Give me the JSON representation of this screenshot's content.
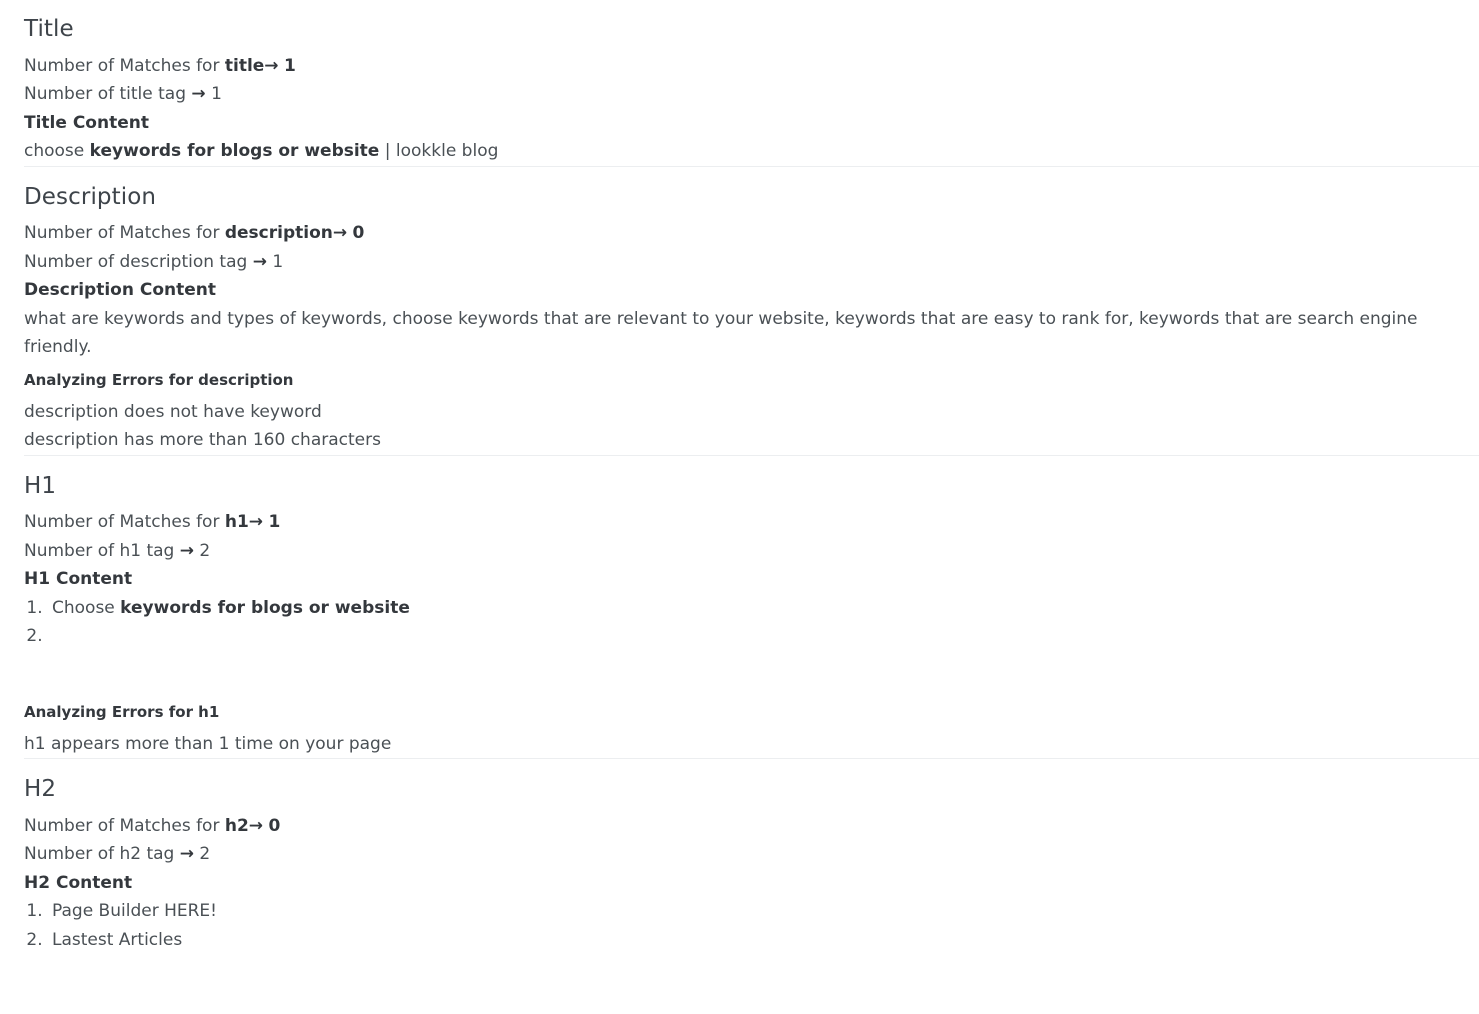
{
  "arrow_glyph": "→",
  "colors": {
    "background": "#ffffff",
    "body_text": "#4a5055",
    "strong_text": "#34383d",
    "heading_text": "#3e444a",
    "divider": "#eceef0"
  },
  "sections": [
    {
      "id": "title",
      "heading": "Title",
      "matches_prefix": "Number of Matches for ",
      "matches_term": "title",
      "matches_value": "1",
      "tag_count_prefix": "Number of title tag ",
      "tag_count_value": "1",
      "content_label": "Title Content",
      "content_plain_before": "choose ",
      "content_strong": "keywords for blogs or website",
      "content_plain_after": " | lookkle blog"
    },
    {
      "id": "description",
      "heading": "Description",
      "matches_prefix": "Number of Matches for ",
      "matches_term": "description",
      "matches_value": "0",
      "tag_count_prefix": "Number of description tag ",
      "tag_count_value": "1",
      "content_label": "Description Content",
      "content_text": "what are keywords and types of keywords, choose keywords that are relevant to your website, keywords that are easy to rank for, keywords that are search engine friendly.",
      "errors_label": "Analyzing Errors for description",
      "errors": [
        "description does not have keyword",
        "description has more than 160 characters"
      ]
    },
    {
      "id": "h1",
      "heading": "H1",
      "matches_prefix": "Number of Matches for ",
      "matches_term": "h1",
      "matches_value": "1",
      "tag_count_prefix": "Number of h1 tag ",
      "tag_count_value": "2",
      "content_label": "H1 Content",
      "items": [
        {
          "plain_before": "Choose ",
          "strong": "keywords for blogs or website",
          "plain_after": ""
        },
        {
          "plain_before": "",
          "strong": "",
          "plain_after": ""
        }
      ],
      "errors_label": "Analyzing Errors for h1",
      "errors": [
        "h1 appears more than 1 time on your page"
      ]
    },
    {
      "id": "h2",
      "heading": "H2",
      "matches_prefix": "Number of Matches for ",
      "matches_term": "h2",
      "matches_value": "0",
      "tag_count_prefix": "Number of h2 tag ",
      "tag_count_value": "2",
      "content_label": "H2 Content",
      "items": [
        {
          "plain_before": "Page Builder HERE!",
          "strong": "",
          "plain_after": ""
        },
        {
          "plain_before": "Lastest Articles",
          "strong": "",
          "plain_after": ""
        }
      ]
    }
  ]
}
